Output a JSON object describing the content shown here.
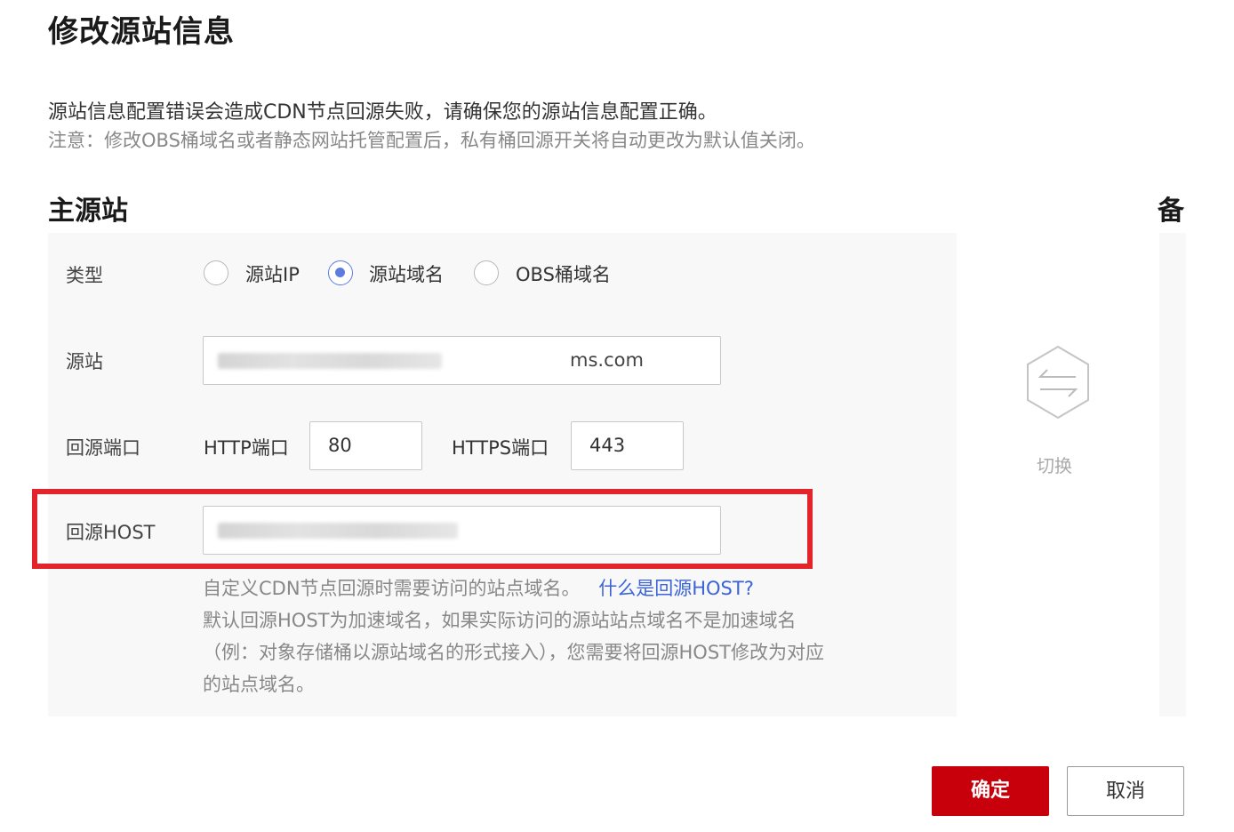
{
  "dialog": {
    "title": "修改源站信息",
    "notice_line1": "源站信息配置错误会造成CDN节点回源失败，请确保您的源站信息配置正确。",
    "notice_line2": "注意：修改OBS桶域名或者静态网站托管配置后，私有桶回源开关将自动更改为默认值关闭。"
  },
  "primary": {
    "title": "主源站",
    "type_label": "类型",
    "type_options": [
      "源站IP",
      "源站域名",
      "OBS桶域名"
    ],
    "selected_type": "源站域名",
    "origin_label": "源站",
    "origin_value": "ms.com",
    "port_label": "回源端口",
    "http_label": "HTTP端口",
    "http_value": "80",
    "https_label": "HTTPS端口",
    "https_value": "443",
    "host_label": "回源HOST",
    "host_value": "",
    "help_line1": "自定义CDN节点回源时需要访问的站点域名。",
    "help_link": "什么是回源HOST?",
    "help_line2": "默认回源HOST为加速域名，如果实际访问的源站站点域名不是加速域名",
    "help_line3": "（例：对象存储桶以源站域名的形式接入），您需要将回源HOST修改为对应",
    "help_line4": "的站点域名。"
  },
  "backup": {
    "title": "备"
  },
  "switch": {
    "label": "切换",
    "icon": "swap-arrows-icon"
  },
  "buttons": {
    "ok": "确定",
    "cancel": "取消"
  },
  "colors": {
    "primary_red": "#c7000b",
    "highlight_red": "#e3242b",
    "radio_blue": "#5e7ce0",
    "link_blue": "#3a64d8"
  }
}
